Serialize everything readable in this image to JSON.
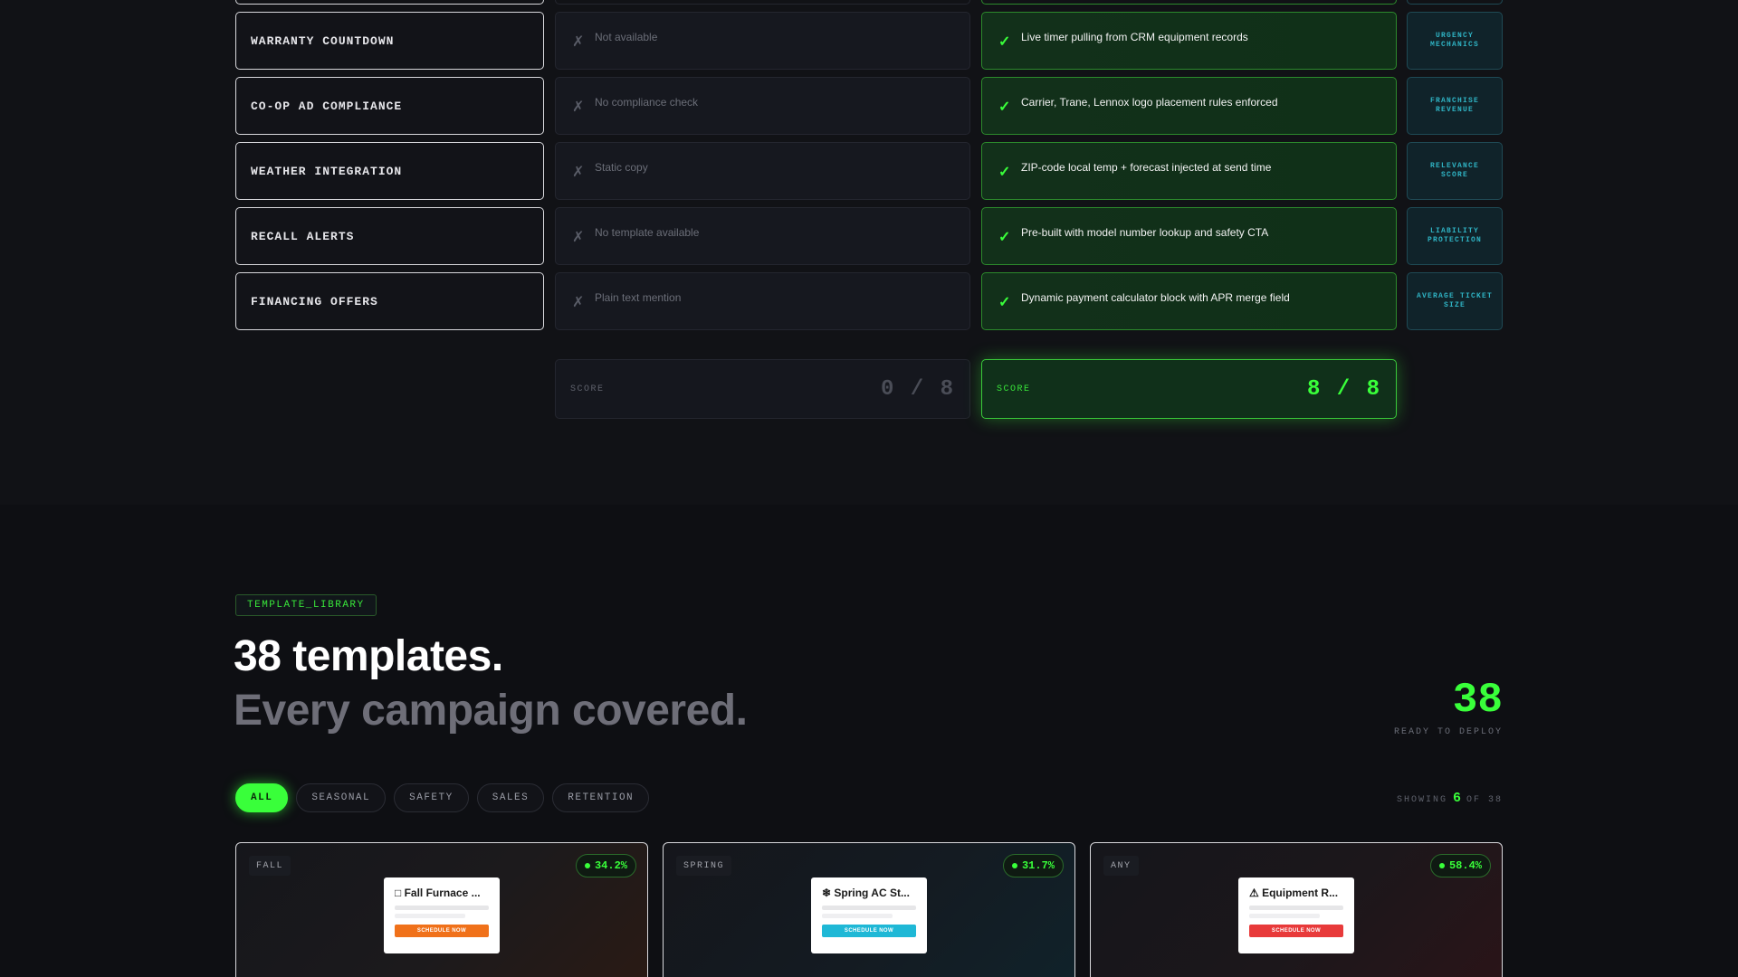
{
  "comparison": {
    "rows": [
      {
        "feature": "WARRANTY COUNTDOWN",
        "old": "Not available",
        "new": "Live timer pulling from CRM equipment records",
        "tag": "URGENCY MECHANICS"
      },
      {
        "feature": "CO-OP AD COMPLIANCE",
        "old": "No compliance check",
        "new": "Carrier, Trane, Lennox logo placement rules enforced",
        "tag": "FRANCHISE REVENUE"
      },
      {
        "feature": "WEATHER INTEGRATION",
        "old": "Static copy",
        "new": "ZIP-code local temp + forecast injected at send time",
        "tag": "RELEVANCE SCORE"
      },
      {
        "feature": "RECALL ALERTS",
        "old": "No template available",
        "new": "Pre-built with model number lookup and safety CTA",
        "tag": "LIABILITY PROTECTION"
      },
      {
        "feature": "FINANCING OFFERS",
        "old": "Plain text mention",
        "new": "Dynamic payment calculator block with APR merge field",
        "tag": "AVERAGE TICKET SIZE"
      }
    ],
    "old_score_label": "SCORE",
    "old_score": "0 / 8",
    "new_score_label": "SCORE",
    "new_score": "8 / 8",
    "x_glyph": "✗",
    "check_glyph": "✓"
  },
  "library": {
    "badge": "TEMPLATE_LIBRARY",
    "title": "38 templates.",
    "subtitle": "Every campaign covered.",
    "count": "38",
    "count_label": "READY TO DEPLOY",
    "filters": [
      "ALL",
      "SEASONAL",
      "SAFETY",
      "SALES",
      "RETENTION"
    ],
    "active_filter": "ALL",
    "showing_prefix": "SHOWING",
    "showing_count": "6",
    "showing_suffix": "OF 38",
    "cards": [
      {
        "season": "FALL",
        "rate": "34.2%",
        "preview_title": "□ Fall Furnace ...",
        "cta": "SCHEDULE NOW",
        "accent": "#f0711a"
      },
      {
        "season": "SPRING",
        "rate": "31.7%",
        "preview_title": "❄ Spring AC St...",
        "cta": "SCHEDULE NOW",
        "accent": "#1fb8d6"
      },
      {
        "season": "ANY",
        "rate": "58.4%",
        "preview_title": "⚠ Equipment R...",
        "cta": "SCHEDULE NOW",
        "accent": "#e83a3a"
      }
    ]
  },
  "colors": {
    "accent_green": "#39ff3a",
    "tag_teal": "#2fb3c4",
    "background": "#0e0f13"
  }
}
